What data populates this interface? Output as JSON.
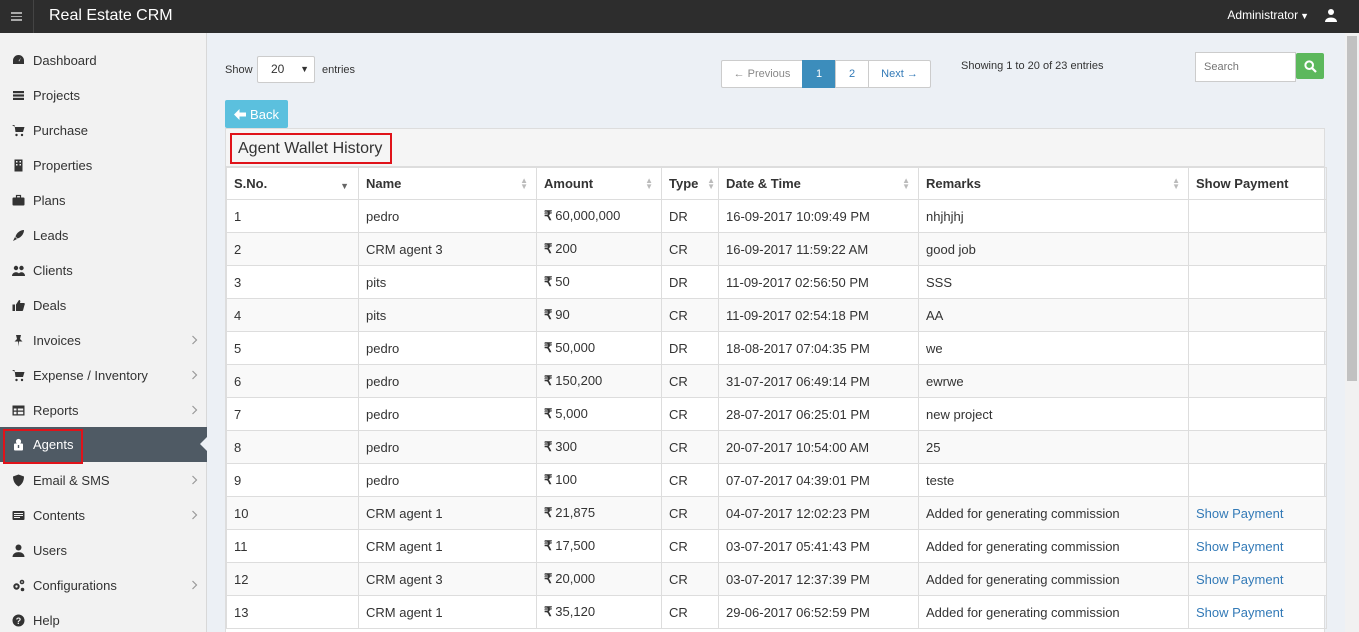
{
  "app": {
    "title": "Real Estate CRM",
    "user": "Administrator"
  },
  "sidebar": {
    "items": [
      {
        "label": "Dashboard",
        "icon": "dashboard-icon",
        "has_sub": false
      },
      {
        "label": "Projects",
        "icon": "projects-icon",
        "has_sub": false
      },
      {
        "label": "Purchase",
        "icon": "cart-icon",
        "has_sub": false
      },
      {
        "label": "Properties",
        "icon": "building-icon",
        "has_sub": false
      },
      {
        "label": "Plans",
        "icon": "briefcase-icon",
        "has_sub": false
      },
      {
        "label": "Leads",
        "icon": "rocket-icon",
        "has_sub": false
      },
      {
        "label": "Clients",
        "icon": "users-icon",
        "has_sub": false
      },
      {
        "label": "Deals",
        "icon": "thumbs-up-icon",
        "has_sub": false
      },
      {
        "label": "Invoices",
        "icon": "pin-icon",
        "has_sub": true
      },
      {
        "label": "Expense / Inventory",
        "icon": "cart-icon",
        "has_sub": true
      },
      {
        "label": "Reports",
        "icon": "table-icon",
        "has_sub": true
      },
      {
        "label": "Agents",
        "icon": "agent-icon",
        "has_sub": false,
        "active": true
      },
      {
        "label": "Email & SMS",
        "icon": "shield-icon",
        "has_sub": true
      },
      {
        "label": "Contents",
        "icon": "contents-icon",
        "has_sub": true
      },
      {
        "label": "Users",
        "icon": "user-icon",
        "has_sub": false
      },
      {
        "label": "Configurations",
        "icon": "gears-icon",
        "has_sub": true
      },
      {
        "label": "Help",
        "icon": "help-icon",
        "has_sub": false
      }
    ]
  },
  "controls": {
    "show_label": "Show",
    "entries_value": "20",
    "entries_label": "entries",
    "pagination": {
      "prev": "← Previous",
      "page1": "1",
      "page2": "2",
      "next": "Next →"
    },
    "showing": "Showing 1 to 20 of 23 entries",
    "search_placeholder": "Search",
    "back": "Back"
  },
  "panel": {
    "title": "Agent Wallet History"
  },
  "table": {
    "headers": [
      "S.No.",
      "Name",
      "Amount",
      "Type",
      "Date & Time",
      "Remarks",
      "Show Payment"
    ],
    "currency_symbol": "₹",
    "rows": [
      {
        "sno": "1",
        "name": "pedro",
        "amount": "60,000,000",
        "type": "DR",
        "datetime": "16-09-2017 10:09:49 PM",
        "remarks": "nhjhjhj",
        "payment": ""
      },
      {
        "sno": "2",
        "name": "CRM agent 3",
        "amount": "200",
        "type": "CR",
        "datetime": "16-09-2017 11:59:22 AM",
        "remarks": "good job",
        "payment": ""
      },
      {
        "sno": "3",
        "name": "pits",
        "amount": "50",
        "type": "DR",
        "datetime": "11-09-2017 02:56:50 PM",
        "remarks": "SSS",
        "payment": ""
      },
      {
        "sno": "4",
        "name": "pits",
        "amount": "90",
        "type": "CR",
        "datetime": "11-09-2017 02:54:18 PM",
        "remarks": "AA",
        "payment": ""
      },
      {
        "sno": "5",
        "name": "pedro",
        "amount": "50,000",
        "type": "DR",
        "datetime": "18-08-2017 07:04:35 PM",
        "remarks": "we",
        "payment": ""
      },
      {
        "sno": "6",
        "name": "pedro",
        "amount": "150,200",
        "type": "CR",
        "datetime": "31-07-2017 06:49:14 PM",
        "remarks": "ewrwe",
        "payment": ""
      },
      {
        "sno": "7",
        "name": "pedro",
        "amount": "5,000",
        "type": "CR",
        "datetime": "28-07-2017 06:25:01 PM",
        "remarks": "new project",
        "payment": ""
      },
      {
        "sno": "8",
        "name": "pedro",
        "amount": "300",
        "type": "CR",
        "datetime": "20-07-2017 10:54:00 AM",
        "remarks": "25",
        "payment": ""
      },
      {
        "sno": "9",
        "name": "pedro",
        "amount": "100",
        "type": "CR",
        "datetime": "07-07-2017 04:39:01 PM",
        "remarks": "teste",
        "payment": ""
      },
      {
        "sno": "10",
        "name": "CRM agent 1",
        "amount": "21,875",
        "type": "CR",
        "datetime": "04-07-2017 12:02:23 PM",
        "remarks": "Added for generating commission",
        "payment": "Show Payment"
      },
      {
        "sno": "11",
        "name": "CRM agent 1",
        "amount": "17,500",
        "type": "CR",
        "datetime": "03-07-2017 05:41:43 PM",
        "remarks": "Added for generating commission",
        "payment": "Show Payment"
      },
      {
        "sno": "12",
        "name": "CRM agent 3",
        "amount": "20,000",
        "type": "CR",
        "datetime": "03-07-2017 12:37:39 PM",
        "remarks": "Added for generating commission",
        "payment": "Show Payment"
      },
      {
        "sno": "13",
        "name": "CRM agent 1",
        "amount": "35,120",
        "type": "CR",
        "datetime": "29-06-2017 06:52:59 PM",
        "remarks": "Added for generating commission",
        "payment": "Show Payment"
      }
    ]
  },
  "colors": {
    "accent": "#3c8dbc",
    "highlight": "#e0131a",
    "sidebar_active": "#4f5a64",
    "search_btn": "#5cb85c",
    "back_btn": "#5bc0de"
  }
}
